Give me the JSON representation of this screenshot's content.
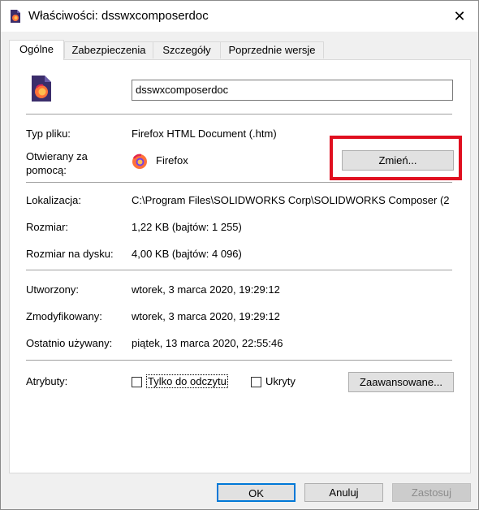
{
  "window": {
    "title": "Właściwości: dsswxcomposerdoc",
    "close_glyph": "✕",
    "app_icon": "firefox-document-icon"
  },
  "tabs": [
    "Ogólne",
    "Zabezpieczenia",
    "Szczegóły",
    "Poprzednie wersje"
  ],
  "general": {
    "file_icon": "firefox-document-icon",
    "file_name": "dsswxcomposerdoc",
    "type_label": "Typ pliku:",
    "type_value": "Firefox HTML Document (.htm)",
    "opens_with_label_1": "Otwierany za",
    "opens_with_label_2": "pomocą:",
    "opens_with_icon": "firefox-icon",
    "opens_with_value": "Firefox",
    "change_button": "Zmień...",
    "location_label": "Lokalizacja:",
    "location_value": "C:\\Program Files\\SOLIDWORKS Corp\\SOLIDWORKS Composer (2",
    "size_label": "Rozmiar:",
    "size_value": "1,22 KB (bajtów: 1 255)",
    "size_on_disk_label": "Rozmiar na dysku:",
    "size_on_disk_value": "4,00 KB (bajtów: 4 096)",
    "created_label": "Utworzony:",
    "created_value": "wtorek, 3 marca 2020, 19:29:12",
    "modified_label": "Zmodyfikowany:",
    "modified_value": "wtorek, 3 marca 2020, 19:29:12",
    "accessed_label": "Ostatnio używany:",
    "accessed_value": "piątek, 13 marca 2020, 22:55:46",
    "attributes_label": "Atrybuty:",
    "readonly_label": "Tylko do odczytu",
    "readonly_checked": false,
    "hidden_label": "Ukryty",
    "hidden_checked": false,
    "advanced_button": "Zaawansowane..."
  },
  "footer": {
    "ok": "OK",
    "cancel": "Anuluj",
    "apply": "Zastosuj"
  },
  "colors": {
    "highlight_box": "#e00f1f",
    "default_button_border": "#0078d7"
  }
}
